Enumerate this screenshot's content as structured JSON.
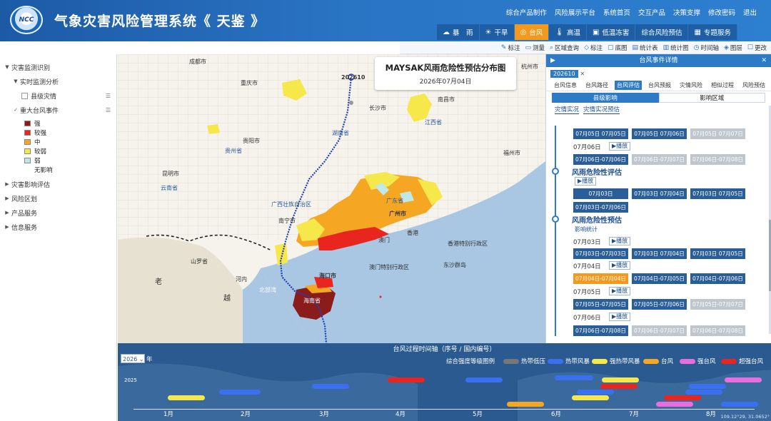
{
  "header": {
    "logo_text": "NCC",
    "title": "气象灾害风险管理系统《 天鉴 》",
    "top_links": [
      "综合产品制作",
      "风险展示平台",
      "系统首页",
      "交互产品",
      "决策支撑",
      "修改密码",
      "退出"
    ],
    "tabs": [
      {
        "label": "暴　雨",
        "icon": "rainstorm-icon",
        "active": false
      },
      {
        "label": "干旱",
        "icon": "drought-icon",
        "active": false
      },
      {
        "label": "台风",
        "icon": "typhoon-icon",
        "active": true
      },
      {
        "label": "高温",
        "icon": "thermometer-icon",
        "active": false
      },
      {
        "label": "低温冻害",
        "icon": "chart-icon",
        "active": false
      },
      {
        "label": "综合风险预估",
        "icon": "",
        "active": false
      },
      {
        "label": "专题服务",
        "icon": "grid-icon",
        "active": false
      }
    ]
  },
  "toolbar": {
    "items": [
      {
        "label": "标注",
        "icon": "pencil-icon"
      },
      {
        "label": "测量",
        "icon": "ruler-icon"
      },
      {
        "label": "区域查询",
        "icon": "magnifier-icon"
      },
      {
        "label": "标注",
        "icon": "tag-icon"
      },
      {
        "label": "底图",
        "icon": "basemap-icon"
      },
      {
        "label": "统计表",
        "icon": "table-icon"
      },
      {
        "label": "统计图",
        "icon": "bar-chart-icon"
      },
      {
        "label": "时间轴",
        "icon": "clock-icon"
      },
      {
        "label": "图层",
        "icon": "layers-icon"
      },
      {
        "label": "更改",
        "icon": "edit-icon"
      }
    ]
  },
  "sidebar": {
    "items": [
      {
        "label": "灾害监测识别",
        "level": 0,
        "arrow": "▼",
        "checkbox": false
      },
      {
        "label": "实时监测分析",
        "level": 1,
        "arrow": "▼",
        "checkbox": false
      },
      {
        "label": "县级灾情",
        "level": 2,
        "arrow": "",
        "checkbox": false,
        "ext": "☰"
      },
      {
        "label": "重大台风事件",
        "level": 1,
        "arrow": "",
        "checkbox": true,
        "ext": "☰"
      }
    ],
    "legend": [
      {
        "label": "强",
        "color": "#8b1c1c"
      },
      {
        "label": "较强",
        "color": "#e8251f"
      },
      {
        "label": "中",
        "color": "#f5a623"
      },
      {
        "label": "较弱",
        "color": "#f6e84a"
      },
      {
        "label": "弱",
        "color": "#bfe8e6"
      },
      {
        "label": "无影响",
        "color": "#ffffff"
      }
    ],
    "bottom_items": [
      {
        "label": "灾害影响评估",
        "arrow": "▶"
      },
      {
        "label": "风险区划",
        "arrow": "▶"
      },
      {
        "label": "产品服务",
        "arrow": "▶"
      },
      {
        "label": "信息服务",
        "arrow": "▶"
      }
    ]
  },
  "map": {
    "title": "MAYSAK风雨危险性预估分布图",
    "date": "2026年07月04日",
    "track_label": "202610",
    "places": [
      {
        "name": "成都市",
        "kind": "city"
      },
      {
        "name": "重庆市",
        "kind": "city"
      },
      {
        "name": "长沙市",
        "kind": "city"
      },
      {
        "name": "南昌市",
        "kind": "city"
      },
      {
        "name": "江西省",
        "kind": "province"
      },
      {
        "name": "贵阳市",
        "kind": "city"
      },
      {
        "name": "贵州省",
        "kind": "province"
      },
      {
        "name": "湖南省",
        "kind": "province"
      },
      {
        "name": "福州市",
        "kind": "city"
      },
      {
        "name": "昆明市",
        "kind": "city"
      },
      {
        "name": "云南省",
        "kind": "province"
      },
      {
        "name": "广西壮族自治区",
        "kind": "province"
      },
      {
        "name": "广东省",
        "kind": "province"
      },
      {
        "name": "广州市",
        "kind": "city"
      },
      {
        "name": "南宁市",
        "kind": "city"
      },
      {
        "name": "澳门",
        "kind": "city"
      },
      {
        "name": "香港",
        "kind": "city"
      },
      {
        "name": "香港特别行政区",
        "kind": "province"
      },
      {
        "name": "澳门特别行政区",
        "kind": "province"
      },
      {
        "name": "东沙群岛",
        "kind": "province"
      },
      {
        "name": "海口市",
        "kind": "city"
      },
      {
        "name": "海南省",
        "kind": "province"
      },
      {
        "name": "北部湾",
        "kind": "sea"
      },
      {
        "name": "杭州市",
        "kind": "city"
      },
      {
        "name": "山罗省",
        "kind": "province"
      },
      {
        "name": "河内",
        "kind": "city"
      },
      {
        "name": "老",
        "kind": "country"
      },
      {
        "name": "越",
        "kind": "country"
      }
    ]
  },
  "right_panel": {
    "title": "台风事件详情",
    "tag": "202610",
    "subtabs": [
      "台风信息",
      "台风路径",
      "台风评估",
      "台风预报",
      "灾情风险",
      "相似过程",
      "风险预估"
    ],
    "active_subtab": "台风评估",
    "mode_tabs": [
      "县级影响",
      "影响区域"
    ],
    "active_mode": "县级影响",
    "inner_tabs": [
      "灾情实况",
      "灾情实况预估"
    ],
    "sections": [
      {
        "heading": "",
        "rows": [
          {
            "date": "",
            "buttons": [
              {
                "t": "07月05日 07月05日",
                "s": "blue"
              },
              {
                "t": "07月05日 07月06日",
                "s": "blue"
              },
              {
                "t": "07月05日 07月07日",
                "s": "gray"
              }
            ]
          },
          {
            "date": "07月06日",
            "play": "▶播放",
            "buttons": [
              {
                "t": "07月06日-07月06日",
                "s": "blue"
              },
              {
                "t": "07月06日-07月07日",
                "s": "gray"
              },
              {
                "t": "07月06日-07月08日",
                "s": "gray"
              }
            ]
          }
        ]
      },
      {
        "heading": "风雨危险性评估",
        "play": "▶播放",
        "rows": [
          {
            "date": "",
            "buttons": [
              {
                "t": "07月03日",
                "s": "blue"
              },
              {
                "t": "07月03日 07月04日",
                "s": "blue"
              },
              {
                "t": "07月03日 07月05日",
                "s": "blue"
              }
            ]
          },
          {
            "date": "",
            "buttons": [
              {
                "t": "07月03日-07月06日",
                "s": "blue"
              }
            ]
          }
        ]
      },
      {
        "heading": "风雨危险性预估",
        "link": "影响统计",
        "rows": [
          {
            "date": "07月03日",
            "play": "▶播放",
            "buttons": [
              {
                "t": "07月03日-07月03日",
                "s": "blue"
              },
              {
                "t": "07月03日 07月04日",
                "s": "blue"
              },
              {
                "t": "07月03日 07月05日",
                "s": "blue"
              }
            ]
          },
          {
            "date": "07月04日",
            "play": "▶播放",
            "buttons": [
              {
                "t": "07月04日-07月04日",
                "s": "orange"
              },
              {
                "t": "07月04日-07月05日",
                "s": "blue"
              },
              {
                "t": "07月04日-07月06日",
                "s": "blue"
              }
            ]
          },
          {
            "date": "07月05日",
            "play": "▶播放",
            "buttons": [
              {
                "t": "07月05日-07月05日",
                "s": "blue"
              },
              {
                "t": "07月05日-07月06日",
                "s": "blue"
              },
              {
                "t": "07月05日-07月07日",
                "s": "gray"
              }
            ]
          },
          {
            "date": "07月06日",
            "play": "▶播放",
            "buttons": [
              {
                "t": "07月06日-07月08日",
                "s": "blue"
              },
              {
                "t": "07月06日-07月07日",
                "s": "gray"
              },
              {
                "t": "07月06日-07月08日",
                "s": "gray"
              }
            ]
          }
        ]
      }
    ]
  },
  "timeline": {
    "title": "台风过程时间轴（序号 / 国内编号）",
    "year": "2026",
    "year_suffix": "年",
    "intensity_label": "综合强度等级图例",
    "legend": [
      {
        "label": "热带低压",
        "color": "#777777"
      },
      {
        "label": "热带风暴",
        "color": "#3a6ff0"
      },
      {
        "label": "强热带风暴",
        "color": "#f6e84a"
      },
      {
        "label": "台风",
        "color": "#f5a623"
      },
      {
        "label": "强台风",
        "color": "#e86ee0"
      },
      {
        "label": "超强台风",
        "color": "#e8251f"
      }
    ],
    "months": [
      "1月",
      "2月",
      "3月",
      "4月",
      "5月",
      "6月",
      "7月",
      "8月"
    ],
    "y_axis": "2025",
    "coord": "109.12°29, 31.0652°",
    "bars_colors": {
      "yellow": "#f6e84a",
      "blue": "#3a6ff0",
      "red": "#e8251f",
      "orange": "#f5a623",
      "pink": "#e86ee0"
    }
  }
}
